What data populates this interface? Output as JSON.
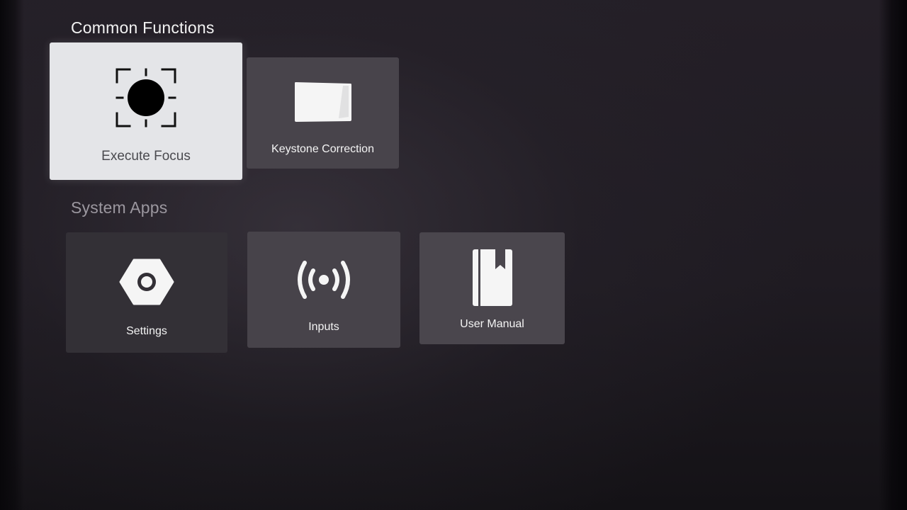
{
  "sections": {
    "common": {
      "title": "Common Functions",
      "tiles": [
        {
          "label": "Execute Focus",
          "icon": "focus-target-icon",
          "focused": true
        },
        {
          "label": "Keystone Correction",
          "icon": "keystone-screen-icon",
          "focused": false
        }
      ]
    },
    "system": {
      "title": "System Apps",
      "tiles": [
        {
          "label": "Settings",
          "icon": "gear-hexagon-icon"
        },
        {
          "label": "Inputs",
          "icon": "signal-broadcast-icon"
        },
        {
          "label": "User Manual",
          "icon": "book-icon"
        }
      ]
    }
  },
  "colors": {
    "background": "#221e25",
    "tile": "#3e3a42",
    "focused_tile": "#e4e5e8",
    "focused_text": "#4a4a4f",
    "text": "#f4f4f4",
    "section_muted": "#9b979f"
  }
}
